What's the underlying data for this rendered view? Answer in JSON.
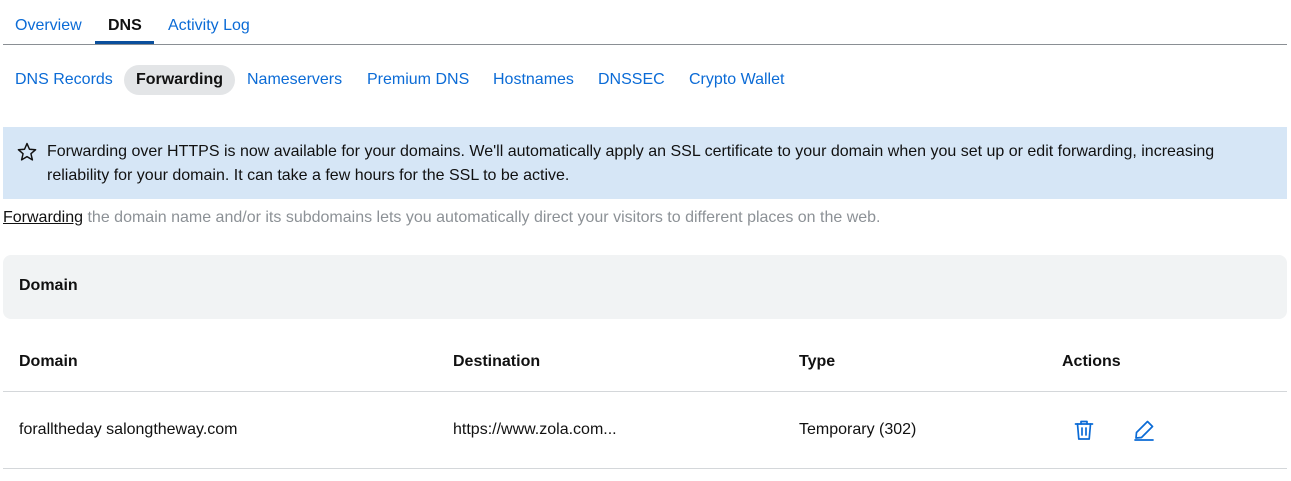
{
  "top_tabs": [
    {
      "label": "Overview"
    },
    {
      "label": "DNS"
    },
    {
      "label": "Activity Log"
    }
  ],
  "sub_tabs": [
    {
      "label": "DNS Records"
    },
    {
      "label": "Forwarding"
    },
    {
      "label": "Nameservers"
    },
    {
      "label": "Premium DNS"
    },
    {
      "label": "Hostnames"
    },
    {
      "label": "DNSSEC"
    },
    {
      "label": "Crypto Wallet"
    }
  ],
  "banner": {
    "icon": "star-icon",
    "message": "Forwarding over HTTPS is now available for your domains. We'll automatically apply an SSL certificate to your domain when you set up or edit forwarding, increasing reliability for your domain. It can take a few hours for the SSL to be active."
  },
  "intro": {
    "link_text": "Forwarding",
    "text": " the domain name and/or its subdomains lets you automatically direct your visitors to different places on the web."
  },
  "section_header": "Domain",
  "table": {
    "columns": [
      "Domain",
      "Destination",
      "Type",
      "Actions"
    ],
    "rows": [
      {
        "domain": "foralltheday salongtheway.com",
        "destination": "https://www.zola.com...",
        "type": "Temporary (302)",
        "actions": [
          "trash-icon",
          "pencil-icon"
        ]
      }
    ]
  },
  "colors": {
    "link": "#0b6bd6",
    "banner_bg": "#d6e6f6",
    "panel_bg": "#f1f3f4",
    "active_pill_bg": "#e3e5e7",
    "muted_text": "#8c9196"
  }
}
